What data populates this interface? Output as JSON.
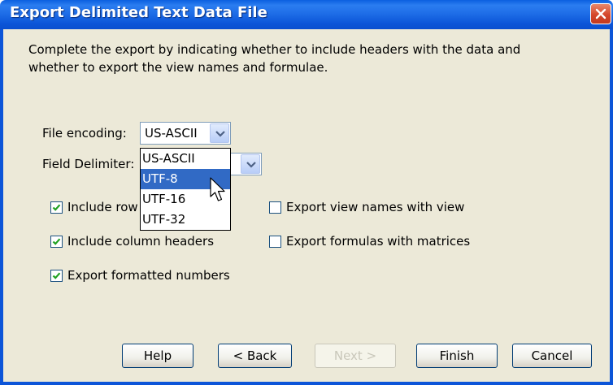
{
  "window": {
    "title": "Export Delimited Text Data File"
  },
  "description": "Complete the export by indicating whether to include headers with the data and whether to export the view names and formulae.",
  "file_encoding": {
    "label": "File encoding:",
    "value": "US-ASCII",
    "options": [
      "US-ASCII",
      "UTF-8",
      "UTF-16",
      "UTF-32"
    ],
    "highlighted": "UTF-8"
  },
  "field_delimiter": {
    "label": "Field Delimiter:"
  },
  "checkboxes": {
    "include_row": {
      "label": "Include row",
      "checked": true
    },
    "include_column_headers": {
      "label": "Include column headers",
      "checked": true
    },
    "export_formatted_numbers": {
      "label": "Export formatted numbers",
      "checked": true
    },
    "export_view_names": {
      "label": "Export view names with view",
      "checked": false
    },
    "export_formulas": {
      "label": "Export formulas with matrices",
      "checked": false
    }
  },
  "buttons": {
    "help": "Help",
    "back": "< Back",
    "next": "Next >",
    "finish": "Finish",
    "cancel": "Cancel"
  },
  "colors": {
    "titlebar": "#0c55d8",
    "client_bg": "#ECE9D8",
    "selection": "#316ac5",
    "check_mark": "#21a121"
  }
}
